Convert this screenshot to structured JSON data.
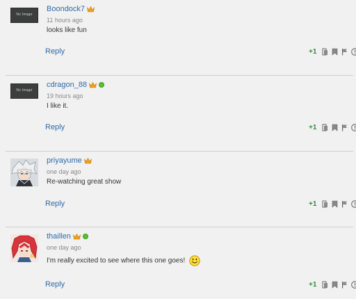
{
  "comments": [
    {
      "username": "Boondock7",
      "timestamp": "11 hours ago",
      "text": "looks like fun",
      "avatar_label": "No Image",
      "reply_label": "Reply",
      "score": "+1"
    },
    {
      "username": "cdragon_88",
      "timestamp": "19 hours ago",
      "text": "I like it.",
      "avatar_label": "No Image",
      "reply_label": "Reply",
      "score": "+1"
    },
    {
      "username": "priyayume",
      "timestamp": "one day ago",
      "text": "Re-watching great show",
      "reply_label": "Reply",
      "score": "+1"
    },
    {
      "username": "thaillen",
      "timestamp": "one day ago",
      "text": "I'm really excited to see where this one goes!",
      "reply_label": "Reply",
      "score": "+1"
    }
  ],
  "colors": {
    "link": "#2f6aa7",
    "score": "#2f8a3a",
    "crown": "#f0a020",
    "online": "#5ac12b"
  },
  "icons": [
    "like-icon",
    "save-icon",
    "flag-icon",
    "report-icon",
    "crown-badge-icon",
    "online-status-icon",
    "smiley-icon"
  ]
}
